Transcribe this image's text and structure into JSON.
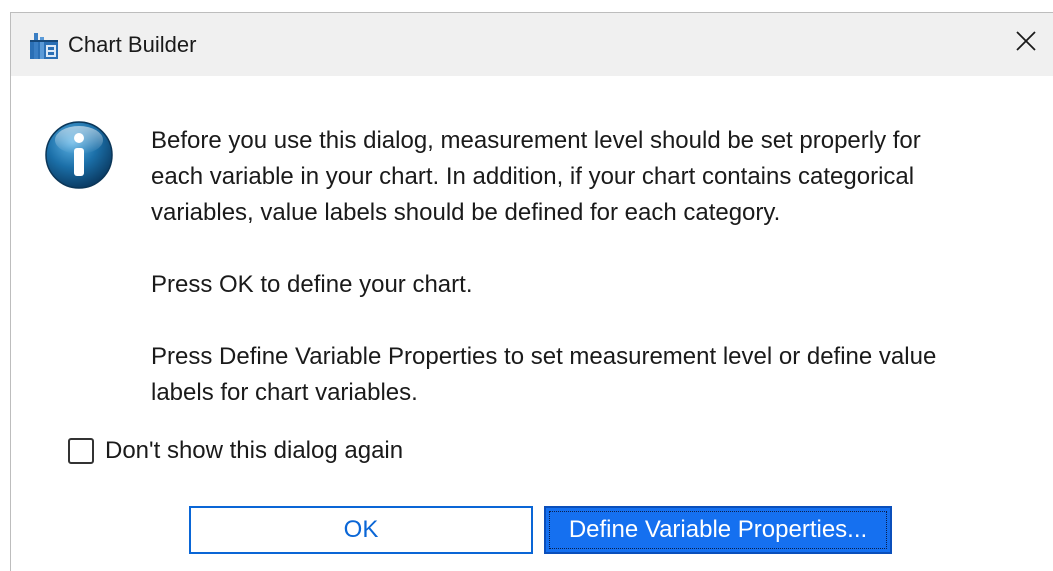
{
  "window": {
    "title": "Chart Builder",
    "close_glyph": "✕",
    "app_icon": "spss-chart-builder-icon"
  },
  "message": {
    "icon": "info-icon",
    "paragraphs": [
      "Before you use this dialog, measurement level should be set properly for\neach variable in your chart. In addition, if your chart contains categorical\nvariables, value labels should be defined for each category.",
      "Press OK to define your chart.",
      "Press Define Variable Properties to set measurement level or define value\nlabels for chart variables."
    ]
  },
  "checkbox": {
    "label": "Don't show this dialog again",
    "checked": false
  },
  "buttons": {
    "ok_label": "OK",
    "define_label": "Define Variable Properties..."
  },
  "colors": {
    "accent": "#1570f0",
    "ok_border": "#0a66d6",
    "titlebar_bg": "#f0f0f0",
    "info_icon": "#1b6fa8"
  }
}
